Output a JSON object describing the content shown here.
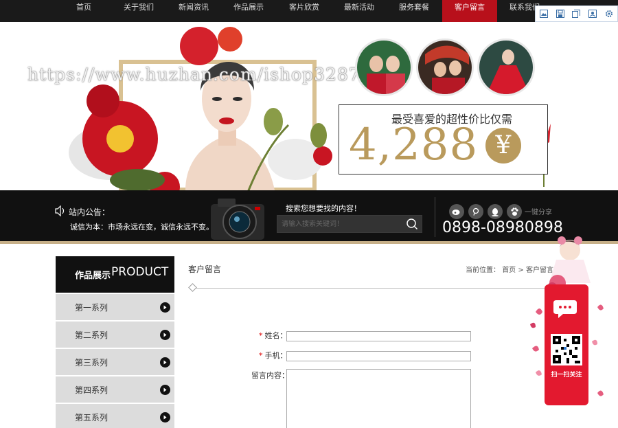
{
  "nav": {
    "items": [
      {
        "label": "首页",
        "active": false
      },
      {
        "label": "关于我们",
        "active": false
      },
      {
        "label": "新闻资讯",
        "active": false
      },
      {
        "label": "作品展示",
        "active": false
      },
      {
        "label": "客片欣赏",
        "active": false
      },
      {
        "label": "最新活动",
        "active": false
      },
      {
        "label": "服务套餐",
        "active": false
      },
      {
        "label": "客户留言",
        "active": true
      },
      {
        "label": "联系我们",
        "active": false
      }
    ],
    "toolbar_icons": [
      "image-icon",
      "save-icon",
      "copy-icon",
      "screenshot-icon",
      "settings-icon"
    ]
  },
  "banner": {
    "watermark": "https://www.huzhan.com/ishop32877",
    "price_caption": "最受喜爱的超性价比仅需",
    "price_value": "4,288",
    "currency_symbol": "¥"
  },
  "infobar": {
    "notice_title": "站内公告：",
    "notice_text": "诚信为本：市场永远在变，诚信永远不变。",
    "search_title": "搜索您想要找的内容！",
    "search_placeholder": "请输入搜索关键词！",
    "share_label": "一键分享",
    "phone": "0898-08980898"
  },
  "sidebar": {
    "title_cn": "作品展示",
    "title_en": "PRODUCT",
    "items": [
      "第一系列",
      "第二系列",
      "第三系列",
      "第四系列",
      "第五系列"
    ]
  },
  "content": {
    "title": "客户留言",
    "breadcrumb_prefix": "当前位置：",
    "breadcrumb_home": "首页",
    "breadcrumb_sep": ">",
    "breadcrumb_current": "客户留言"
  },
  "form": {
    "required_mark": "*",
    "name_label": "姓名：",
    "name_value": "",
    "phone_label": "手机：",
    "phone_value": "",
    "message_label": "留言内容：",
    "message_value": ""
  },
  "float_widget": {
    "qr_label": "扫一扫关注"
  },
  "colors": {
    "nav_bg": "#1a1a1a",
    "accent_red": "#b8101b",
    "gold": "#b99a5c",
    "widget_red": "#e3192f"
  }
}
